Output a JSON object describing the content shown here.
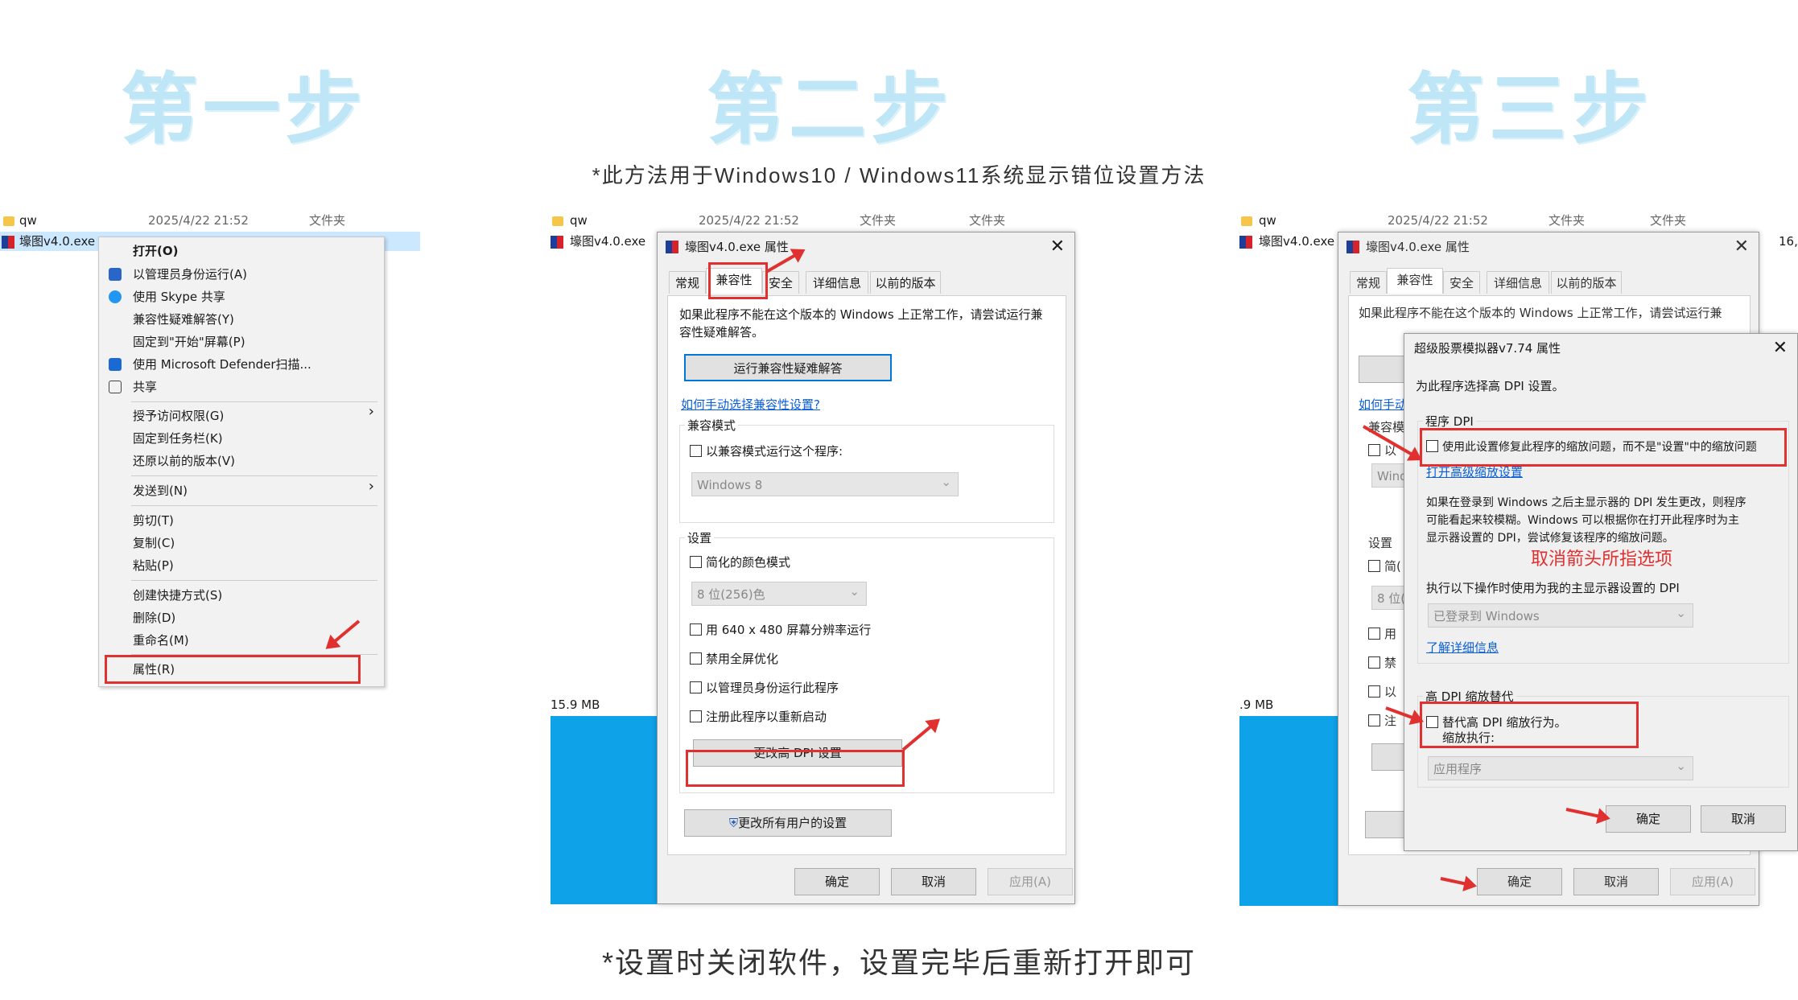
{
  "steps": {
    "one": "第一步",
    "two": "第二步",
    "three": "第三步"
  },
  "subtitle": "*此方法用于Windows10 / Windows11系统显示错位设置方法",
  "bottom_note": "*设置时关闭软件，设置完毕后重新打开即可",
  "explorer": {
    "folder_name": "qw",
    "folder_date": "2025/4/22 21:52",
    "folder_type": "文件夹",
    "exe_name": "壕图v4.0.exe",
    "size_left": "15.9 MB",
    "size_right": ".9 MB",
    "extra": "16,",
    "type_col": "文件夹"
  },
  "context_menu": {
    "open": "打开(O)",
    "run_admin": "以管理员身份运行(A)",
    "skype": "使用 Skype 共享",
    "troubleshoot": "兼容性疑难解答(Y)",
    "pin_start": "固定到\"开始\"屏幕(P)",
    "defender": "使用 Microsoft Defender扫描...",
    "share": "共享",
    "grant": "授予访问权限(G)",
    "pin_taskbar": "固定到任务栏(K)",
    "restore": "还原以前的版本(V)",
    "send_to": "发送到(N)",
    "cut": "剪切(T)",
    "copy": "复制(C)",
    "paste": "粘贴(P)",
    "shortcut": "创建快捷方式(S)",
    "delete": "删除(D)",
    "rename": "重命名(M)",
    "properties": "属性(R)"
  },
  "props": {
    "title": "壕图v4.0.exe 属性",
    "tabs": [
      "常规",
      "兼容性",
      "安全",
      "详细信息",
      "以前的版本"
    ],
    "intro": "如果此程序不能在这个版本的 Windows 上正常工作，请尝试运行兼容性疑难解答。",
    "intro_a": "如果此程序不能在这个版本的 Windows 上正常工作，请尝试运行兼",
    "intro_b": "容性疑难解答。",
    "run_troubleshooter": "运行兼容性疑难解答",
    "manual_link": "如何手动选择兼容性设置?",
    "compat_mode": "兼容模式",
    "compat_cb": "以兼容模式运行这个程序:",
    "compat_select": "Windows 8",
    "settings": "设置",
    "reduced_color": "简化的颜色模式",
    "color_select": "8 位(256)色",
    "res_640": "用 640 x 480 屏幕分辨率运行",
    "disable_fullscreen": "禁用全屏优化",
    "run_as_admin": "以管理员身份运行此程序",
    "register_restart": "注册此程序以重新启动",
    "change_dpi": "更改高 DPI 设置",
    "all_users": "更改所有用户的设置",
    "ok": "确定",
    "cancel": "取消",
    "apply": "应用(A)"
  },
  "step3": {
    "snip_ceng": "如何手动",
    "snip_jianrong": "兼容模",
    "snip_yi": "以",
    "snip_wind": "Wind",
    "snip_8wei": "8 位(",
    "snip_jian": "简(",
    "snip_yong": "用",
    "snip_jin": "禁",
    "snip_yi2": "以",
    "snip_zhu": "注"
  },
  "dpi": {
    "title": "超级股票模拟器v7.74 属性",
    "choose": "为此程序选择高 DPI 设置。",
    "program_dpi": "程序 DPI",
    "use_setting": "使用此设置修复此程序的缩放问题，而不是\"设置\"中的缩放问题",
    "open_adv": "打开高级缩放设置",
    "desc_1": "如果在登录到 Windows 之后主显示器的 DPI 发生更改，则程序",
    "desc_2": "可能看起来较模糊。Windows 可以根据你在打开此程序时为主",
    "desc_3": "显示器设置的 DPI，尝试修复该程序的缩放问题。",
    "red_note": "取消箭头所指选项",
    "perform": "执行以下操作时使用为我的主显示器设置的 DPI",
    "signed_in": "已登录到 Windows",
    "learn": "了解详细信息",
    "override": "高 DPI 缩放替代",
    "override_cb": "替代高 DPI 缩放行为。",
    "override_sub": "缩放执行:",
    "app": "应用程序",
    "ok": "确定",
    "cancel": "取消"
  }
}
